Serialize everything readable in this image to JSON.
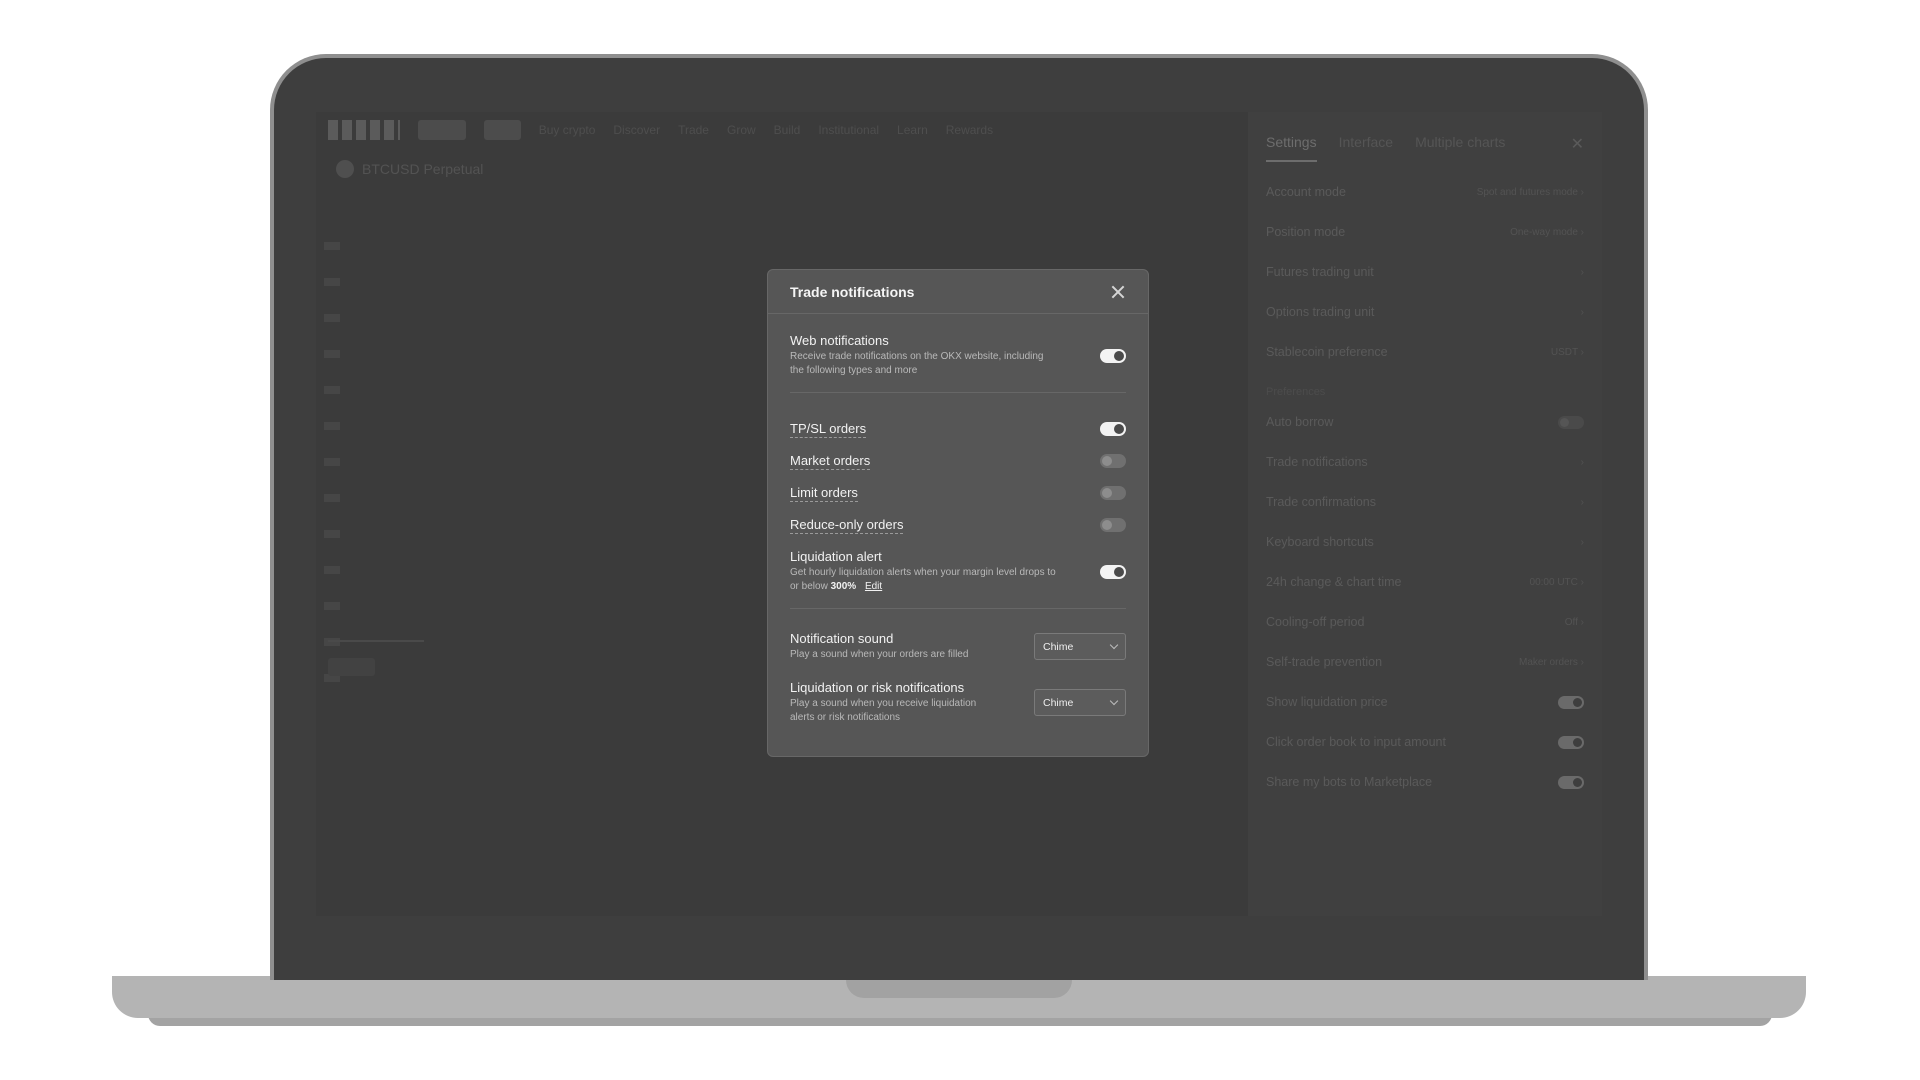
{
  "background_app": {
    "nav_items": [
      "Buy crypto",
      "Discover",
      "Trade",
      "Grow",
      "Build",
      "Institutional",
      "Learn",
      "Rewards"
    ],
    "pair": "BTCUSD Perpetual",
    "settings_panel": {
      "tabs": [
        "Settings",
        "Interface",
        "Multiple charts"
      ],
      "rows_top": [
        {
          "label": "Account mode",
          "value": "Spot and futures mode"
        },
        {
          "label": "Position mode",
          "value": "One-way mode"
        },
        {
          "label": "Futures trading unit",
          "value": ""
        },
        {
          "label": "Options trading unit",
          "value": ""
        },
        {
          "label": "Stablecoin preference",
          "value": "USDT"
        }
      ],
      "section_label": "Preferences",
      "rows_bottom": [
        {
          "label": "Auto borrow",
          "value": "",
          "toggle": "off"
        },
        {
          "label": "Trade notifications",
          "value": ""
        },
        {
          "label": "Trade confirmations",
          "value": ""
        },
        {
          "label": "Keyboard shortcuts",
          "value": ""
        },
        {
          "label": "24h change & chart time",
          "value": "00:00 UTC"
        },
        {
          "label": "Cooling-off period",
          "value": "Off"
        },
        {
          "label": "Self-trade prevention",
          "value": "Maker orders"
        },
        {
          "label": "Show liquidation price",
          "value": "",
          "toggle": "on"
        },
        {
          "label": "Click order book to input amount",
          "value": "",
          "toggle": "on"
        },
        {
          "label": "Share my bots to Marketplace",
          "value": "",
          "toggle": "on"
        }
      ]
    }
  },
  "modal": {
    "title": "Trade notifications",
    "web_notifications": {
      "label": "Web notifications",
      "desc_line1": "Receive trade notifications on the OKX website, including",
      "desc_line2": "the following types and more",
      "state": "on"
    },
    "order_types": [
      {
        "label": "TP/SL orders",
        "state": "on"
      },
      {
        "label": "Market orders",
        "state": "off"
      },
      {
        "label": "Limit orders",
        "state": "off"
      },
      {
        "label": "Reduce-only orders",
        "state": "off"
      }
    ],
    "liquidation_alert": {
      "label": "Liquidation alert",
      "desc_line1": "Get hourly liquidation alerts when your margin level drops to",
      "desc_line2_prefix": "or below",
      "percent": "300%",
      "edit_label": "Edit",
      "state": "on"
    },
    "notification_sound": {
      "label": "Notification sound",
      "desc": "Play a sound when your orders are filled",
      "selected": "Chime"
    },
    "risk_sound": {
      "label": "Liquidation or risk notifications",
      "desc_line1": "Play a sound when you receive liquidation",
      "desc_line2": "alerts or risk notifications",
      "selected": "Chime"
    }
  }
}
